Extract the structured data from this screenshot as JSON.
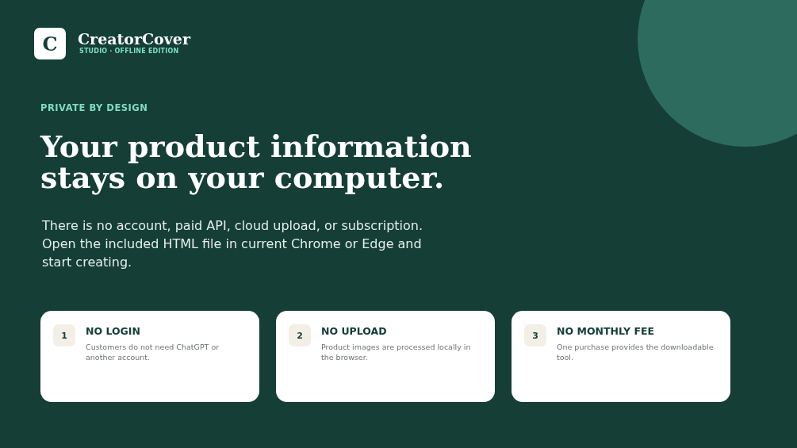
{
  "brand": {
    "logo_letter": "C",
    "name": "CreatorCover",
    "tagline": "STUDIO · OFFLINE EDITION"
  },
  "eyebrow": "PRIVATE BY DESIGN",
  "headline": [
    "Your product information",
    "stays on your computer."
  ],
  "intro": "There is no account, paid API, cloud upload, or subscription. Open the included HTML file in current Chrome or Edge and start creating.",
  "features": [
    {
      "number": "1",
      "title": "NO LOGIN",
      "text": "Customers do not need ChatGPT or another account."
    },
    {
      "number": "2",
      "title": "NO UPLOAD",
      "text": "Product images are processed locally in the browser."
    },
    {
      "number": "3",
      "title": "NO MONTHLY FEE",
      "text": "One purchase provides the downloadable tool."
    }
  ]
}
